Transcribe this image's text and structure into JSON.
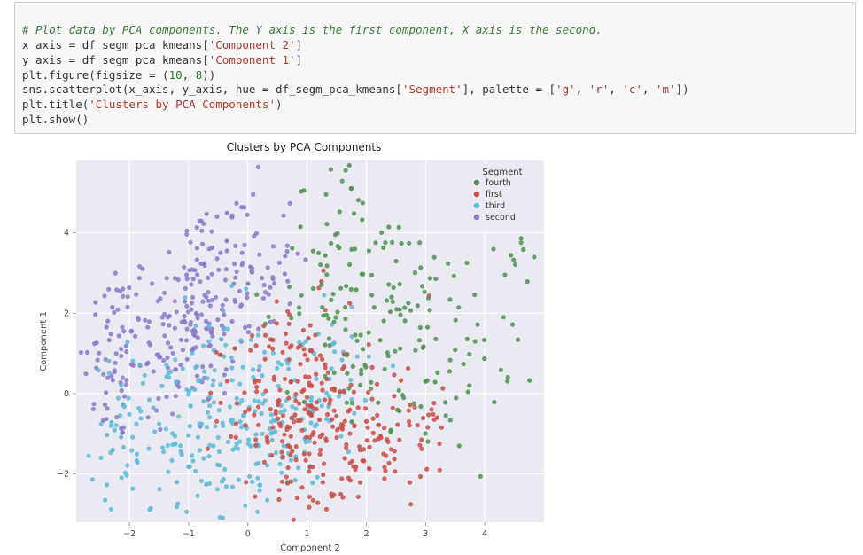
{
  "code": {
    "comment": "# Plot data by PCA components. The Y axis is the first component, X axis is the second.",
    "line2_a": "x_axis = df_segm_pca_kmeans[",
    "line2_str": "'Component 2'",
    "line2_b": "]",
    "line3_a": "y_axis = df_segm_pca_kmeans[",
    "line3_str": "'Component 1'",
    "line3_b": "]",
    "line4_a": "plt.figure(figsize = (",
    "line4_n1": "10",
    "line4_c": ", ",
    "line4_n2": "8",
    "line4_b": "))",
    "line5_a": "sns.scatterplot(x_axis, y_axis, hue = df_segm_pca_kmeans[",
    "line5_seg": "'Segment'",
    "line5_b": "], palette = [",
    "line5_g": "'g'",
    "line5_r": "'r'",
    "line5_c2": "'c'",
    "line5_m": "'m'",
    "line5_end": "])",
    "line6_a": "plt.title(",
    "line6_str": "'Clusters by PCA Components'",
    "line6_b": ")",
    "line7": "plt.show()"
  },
  "chart_data": {
    "type": "scatter",
    "title": "Clusters by PCA Components",
    "xlabel": "Component 2",
    "ylabel": "Component 1",
    "xlim": [
      -2.9,
      5.0
    ],
    "ylim": [
      -3.2,
      5.8
    ],
    "xticks": [
      -2,
      -1,
      0,
      1,
      2,
      3,
      4
    ],
    "yticks": [
      -2,
      0,
      2,
      4
    ],
    "legend": {
      "title": "Segment",
      "entries": [
        {
          "label": "fourth",
          "color": "#4e924e"
        },
        {
          "label": "first",
          "color": "#c94b45"
        },
        {
          "label": "third",
          "color": "#5bbad6"
        },
        {
          "label": "second",
          "color": "#8b78c9"
        }
      ]
    },
    "clusters": [
      {
        "name": "second",
        "color": "#8b78c9",
        "centers": [
          {
            "cx": -2.2,
            "cy": 1.0,
            "n": 70,
            "sx": 0.28,
            "sy": 1.2
          },
          {
            "cx": -1.0,
            "cy": 2.0,
            "n": 140,
            "sx": 0.45,
            "sy": 1.4
          },
          {
            "cx": -0.1,
            "cy": 2.6,
            "n": 90,
            "sx": 0.45,
            "sy": 1.2
          }
        ]
      },
      {
        "name": "third",
        "color": "#5bbad6",
        "centers": [
          {
            "cx": -2.1,
            "cy": -0.6,
            "n": 40,
            "sx": 0.28,
            "sy": 0.9
          },
          {
            "cx": -1.0,
            "cy": -0.6,
            "n": 100,
            "sx": 0.5,
            "sy": 1.2
          },
          {
            "cx": 0.1,
            "cy": -0.8,
            "n": 110,
            "sx": 0.55,
            "sy": 1.1
          },
          {
            "cx": 1.1,
            "cy": -0.4,
            "n": 70,
            "sx": 0.45,
            "sy": 0.9
          }
        ]
      },
      {
        "name": "first",
        "color": "#c94b45",
        "centers": [
          {
            "cx": 0.2,
            "cy": 0.2,
            "n": 50,
            "sx": 0.35,
            "sy": 0.9
          },
          {
            "cx": 0.9,
            "cy": -0.7,
            "n": 140,
            "sx": 0.4,
            "sy": 1.4
          },
          {
            "cx": 1.6,
            "cy": -1.0,
            "n": 60,
            "sx": 0.5,
            "sy": 1.0
          },
          {
            "cx": 2.4,
            "cy": -0.9,
            "n": 40,
            "sx": 0.4,
            "sy": 0.8
          },
          {
            "cx": 3.0,
            "cy": -1.2,
            "n": 20,
            "sx": 0.35,
            "sy": 0.6
          }
        ]
      },
      {
        "name": "fourth",
        "color": "#4e924e",
        "centers": [
          {
            "cx": 1.4,
            "cy": 3.2,
            "n": 60,
            "sx": 0.4,
            "sy": 1.6
          },
          {
            "cx": 2.2,
            "cy": 1.8,
            "n": 70,
            "sx": 0.55,
            "sy": 1.6
          },
          {
            "cx": 3.1,
            "cy": 1.2,
            "n": 40,
            "sx": 0.55,
            "sy": 1.3
          },
          {
            "cx": 4.2,
            "cy": 1.6,
            "n": 25,
            "sx": 0.45,
            "sy": 1.6
          },
          {
            "cx": 4.7,
            "cy": 3.0,
            "n": 10,
            "sx": 0.25,
            "sy": 0.8
          }
        ]
      }
    ]
  }
}
